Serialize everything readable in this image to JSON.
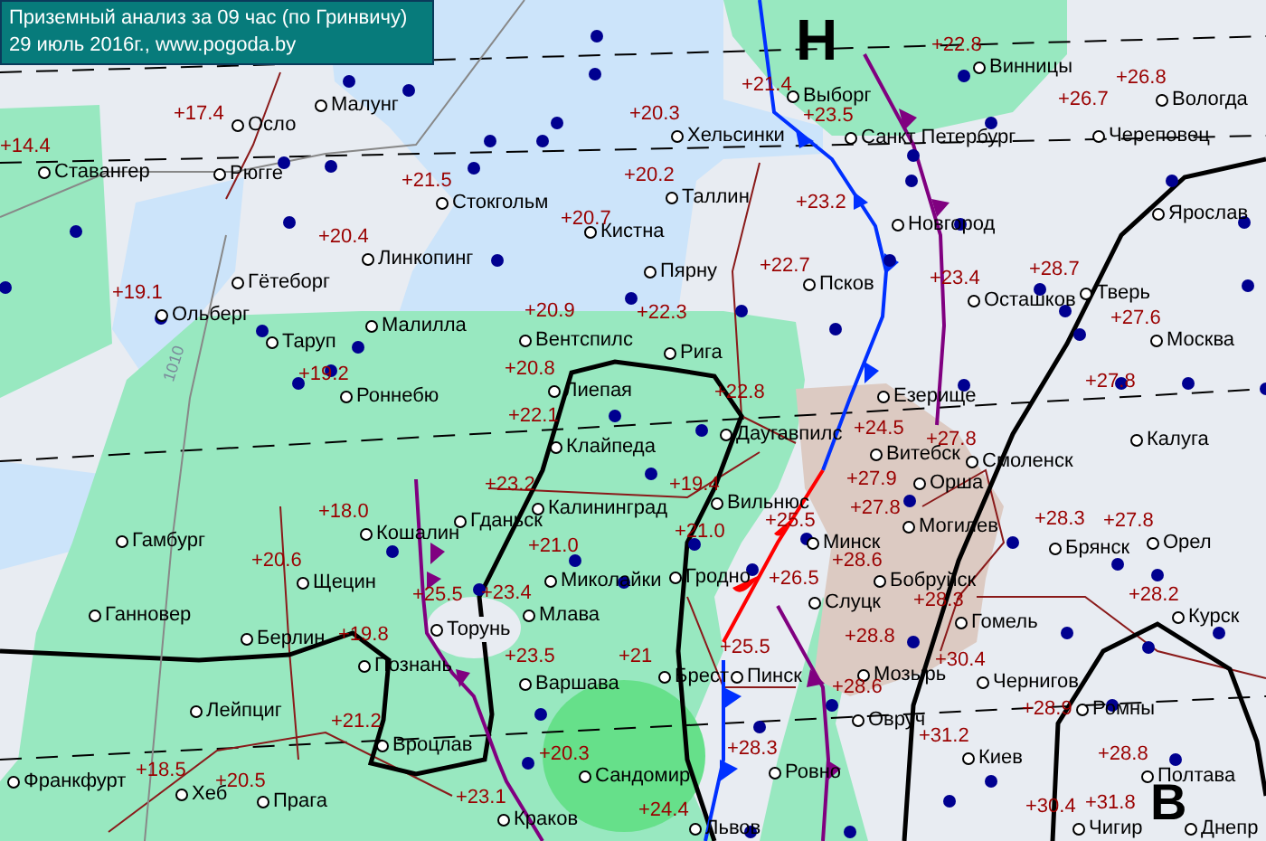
{
  "header": {
    "title": "Приземный анализ за 09 час (по Гринвичу)",
    "subtitle": "29 июль 2016г.,  www.pogoda.by"
  },
  "pressure_centers": [
    {
      "letter": "Н"
    },
    {
      "letter": "В"
    }
  ],
  "isobar_labels": [
    "1010"
  ],
  "cities": [
    {
      "name": "Осло"
    },
    {
      "name": "Малунг"
    },
    {
      "name": "Ставангер"
    },
    {
      "name": "Рюгге"
    },
    {
      "name": "Гётеборг"
    },
    {
      "name": "Линкопинг"
    },
    {
      "name": "Ольберг"
    },
    {
      "name": "Таруп"
    },
    {
      "name": "Малилла"
    },
    {
      "name": "Роннебю"
    },
    {
      "name": "Выборг"
    },
    {
      "name": "Хельсинки"
    },
    {
      "name": "Санкт Петербург"
    },
    {
      "name": "Винницы"
    },
    {
      "name": "Вологда"
    },
    {
      "name": "Череповец"
    },
    {
      "name": "Стокгольм"
    },
    {
      "name": "Кистна"
    },
    {
      "name": "Таллин"
    },
    {
      "name": "Новгород"
    },
    {
      "name": "Ярослав"
    },
    {
      "name": "Пярну"
    },
    {
      "name": "Псков"
    },
    {
      "name": "Осташков"
    },
    {
      "name": "Тверь"
    },
    {
      "name": "Вентспилс"
    },
    {
      "name": "Рига"
    },
    {
      "name": "Москва"
    },
    {
      "name": "Лиепая"
    },
    {
      "name": "Езерище"
    },
    {
      "name": "Клайпеда"
    },
    {
      "name": "Даугавпилс"
    },
    {
      "name": "Витебск"
    },
    {
      "name": "Смоленск"
    },
    {
      "name": "Калуга"
    },
    {
      "name": "Гамбург"
    },
    {
      "name": "Кошалин"
    },
    {
      "name": "Гданьск"
    },
    {
      "name": "Калининград"
    },
    {
      "name": "Вильнюс"
    },
    {
      "name": "Минск"
    },
    {
      "name": "Орша"
    },
    {
      "name": "Могилев"
    },
    {
      "name": "Брянск"
    },
    {
      "name": "Орел"
    },
    {
      "name": "Щецин"
    },
    {
      "name": "Миколайки"
    },
    {
      "name": "Гродно"
    },
    {
      "name": "Бобруйск"
    },
    {
      "name": "Ганновер"
    },
    {
      "name": "Берлин"
    },
    {
      "name": "Торунь"
    },
    {
      "name": "Млава"
    },
    {
      "name": "Слуцк"
    },
    {
      "name": "Гомель"
    },
    {
      "name": "Курск"
    },
    {
      "name": "Познань"
    },
    {
      "name": "Варшава"
    },
    {
      "name": "Брест"
    },
    {
      "name": "Пинск"
    },
    {
      "name": "Мозырь"
    },
    {
      "name": "Чернигов"
    },
    {
      "name": "Лейпциг"
    },
    {
      "name": "Овруч"
    },
    {
      "name": "Ромны"
    },
    {
      "name": "Вроцлав"
    },
    {
      "name": "Киев"
    },
    {
      "name": "Франкфурт"
    },
    {
      "name": "Сандомир"
    },
    {
      "name": "Ровно"
    },
    {
      "name": "Полтава"
    },
    {
      "name": "Хеб"
    },
    {
      "name": "Прага"
    },
    {
      "name": "Краков"
    },
    {
      "name": "Львов"
    },
    {
      "name": "Чигир"
    },
    {
      "name": "Днепр"
    }
  ],
  "temperatures": [
    "+17.4",
    "+14.4",
    "+21.5",
    "+20.4",
    "+19.1",
    "+19.2",
    "+21.4",
    "+20.3",
    "+23.5",
    "+20.2",
    "+20.7",
    "+22.7",
    "+20.9",
    "+22.3",
    "+20.8",
    "+22.8",
    "+22.1",
    "+22.8",
    "+26.7",
    "+26.8",
    "+23.2",
    "+23.4",
    "+28.7",
    "+27.6",
    "+24.5",
    "+27.8",
    "+27.8",
    "+27.9",
    "+27.8",
    "+28.3",
    "+27.8",
    "+28.6",
    "+28.3",
    "+28.2",
    "+28.8",
    "+30.4",
    "+28.6",
    "+28.9",
    "+31.2",
    "+28.8",
    "+30.4",
    "+31.8",
    "+18.0",
    "+20.6",
    "+19.8",
    "+21.2",
    "+18.5",
    "+20.5",
    "+23.2",
    "+19.4",
    "+21.0",
    "+21.0",
    "+25.5",
    "+25.5",
    "+23.4",
    "+26.5",
    "+23.5",
    "+21",
    "+25.5",
    "+20.3",
    "+28.3",
    "+23.1",
    "+24.4"
  ]
}
